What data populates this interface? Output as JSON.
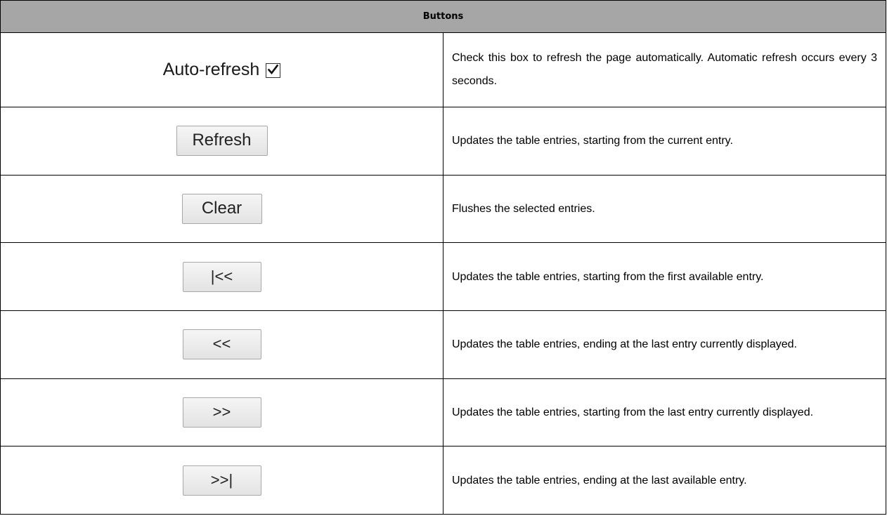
{
  "table": {
    "header": "Buttons",
    "rows": [
      {
        "control": "Auto-refresh",
        "control_type": "checkbox",
        "checked": true,
        "description": "Check this box to refresh the page automatically. Automatic refresh occurs every 3 seconds."
      },
      {
        "control": "Refresh",
        "control_type": "button",
        "description": "Updates the table entries, starting from the current entry."
      },
      {
        "control": "Clear",
        "control_type": "button",
        "description": "Flushes the selected entries."
      },
      {
        "control": "|<<",
        "control_type": "button",
        "description": "Updates the table entries, starting from the first available entry."
      },
      {
        "control": "<<",
        "control_type": "button",
        "description": "Updates the table entries, ending at the last entry currently displayed."
      },
      {
        "control": ">>",
        "control_type": "button",
        "description": "Updates the table entries, starting from the last entry currently displayed."
      },
      {
        "control": ">>|",
        "control_type": "button",
        "description": "Updates the table entries, ending at the last available entry."
      }
    ]
  },
  "icons": {
    "checkmark": "checkmark-icon"
  },
  "colors": {
    "header_background": "#a6a6a6",
    "border": "#000000",
    "button_background": "#e8e8e8"
  }
}
